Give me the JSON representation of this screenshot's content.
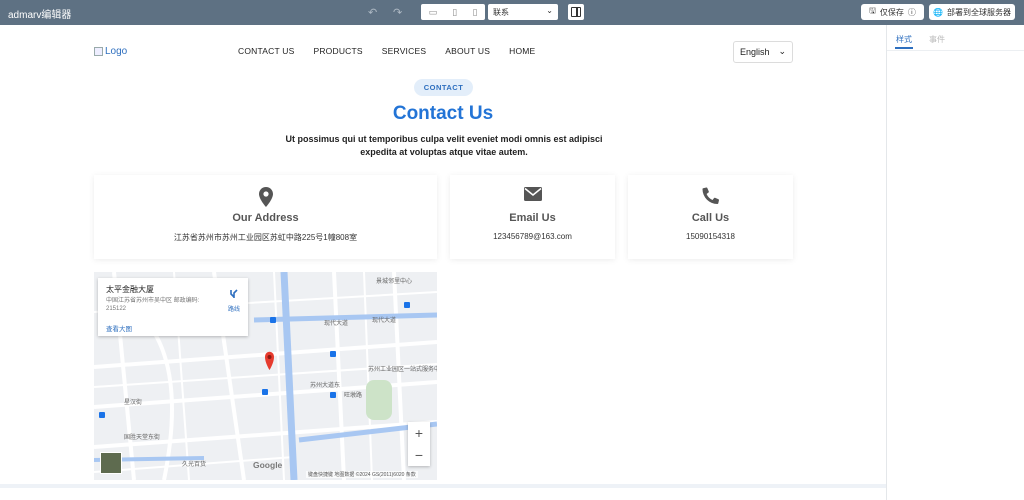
{
  "toolbar": {
    "app_title": "admarv编辑器",
    "page_select": "联系",
    "save_label": "仅保存",
    "deploy_label": "部署到全球服务器"
  },
  "right_panel": {
    "tab_style": "样式",
    "tab_events": "事件"
  },
  "site": {
    "logo_alt": "Logo",
    "nav": [
      "CONTACT US",
      "PRODUCTS",
      "SERVICES",
      "ABOUT US",
      "HOME"
    ],
    "language": "English"
  },
  "contact": {
    "badge": "CONTACT",
    "heading": "Contact Us",
    "subtitle": "Ut possimus qui ut temporibus culpa velit eveniet modi omnis est adipisci expedita at voluptas atque vitae autem.",
    "cards": [
      {
        "title": "Our Address",
        "text": "江苏省苏州市苏州工业园区苏虹中路225号1幢808室",
        "icon": "map-pin-icon"
      },
      {
        "title": "Email Us",
        "text": "123456789@163.com",
        "icon": "envelope-icon"
      },
      {
        "title": "Call Us",
        "text": "15090154318",
        "icon": "phone-icon"
      }
    ]
  },
  "map": {
    "place_title": "太平金融大厦",
    "place_address": "中国江苏省苏州市吴中区 邮政编码: 215122",
    "route_label": "路线",
    "view_larger": "查看大图",
    "google_label": "Google",
    "attribution": "键盘快捷键  地图数据 ©2024 GS(2011)6020  条款",
    "labels": {
      "road_modern": "现代大道",
      "road_modern2": "现代大道",
      "road_suzhou": "苏州大道东",
      "road_xinghan": "星汉街",
      "service_center": "苏州工业园区一站式服务中心",
      "neighborhood": "景城邻里中心",
      "shop": "久光百货",
      "road_guosheng": "国胜天堂东街",
      "road_wanghu": "旺墩路"
    }
  },
  "colors": {
    "toolbar_bg": "#5e7183",
    "accent": "#2374d6"
  }
}
